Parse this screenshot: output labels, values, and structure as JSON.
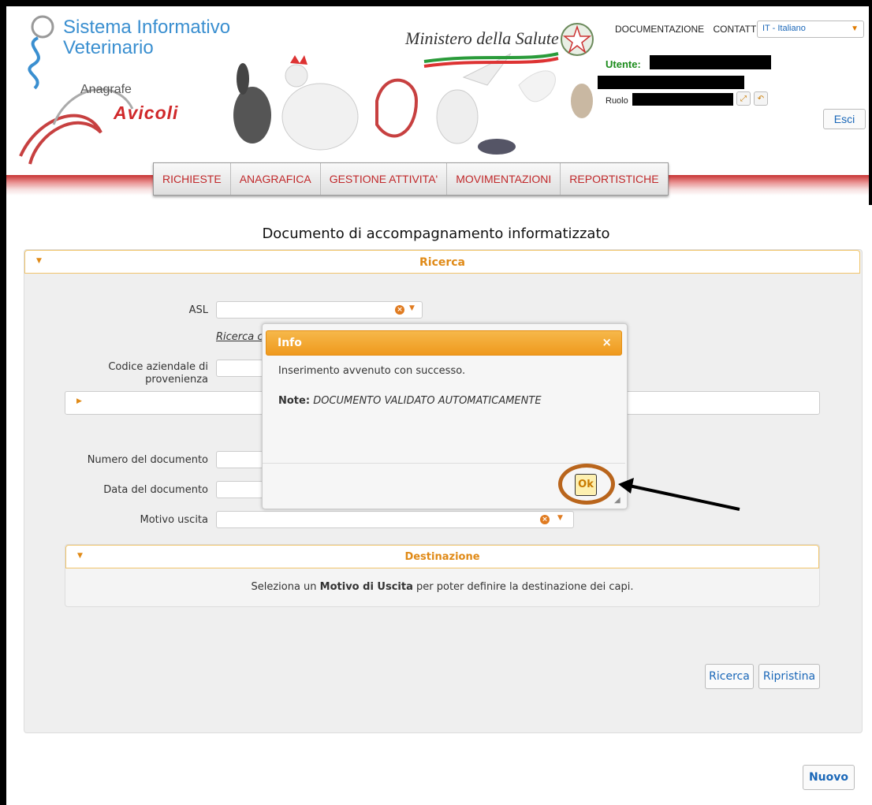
{
  "header": {
    "title_line1": "Sistema Informativo",
    "title_line2": "Veterinario",
    "subtitle": "Anagrafe",
    "brand": "Avicoli",
    "ministry": "Ministero della Salute",
    "links": [
      "DOCUMENTAZIONE",
      "CONTATTI"
    ],
    "language": "IT - Italiano",
    "user_label": "Utente:",
    "role_label": "Ruolo",
    "logout": "Esci"
  },
  "nav": [
    "RICHIESTE",
    "ANAGRAFICA",
    "GESTIONE ATTIVITA'",
    "MOVIMENTAZIONI",
    "REPORTISTICHE"
  ],
  "page": {
    "title": "Documento di accompagnamento informatizzato",
    "search_panel": "Ricerca",
    "fields": {
      "asl": "ASL",
      "ricerca_link": "Ricerca c",
      "codice_line1": "Codice aziendale di",
      "codice_line2": "provenienza",
      "numero": "Numero del documento",
      "data": "Data del documento",
      "motivo": "Motivo uscita"
    },
    "destination": {
      "title": "Destinazione",
      "msg_pre": "Seleziona un ",
      "msg_bold": "Motivo di Uscita",
      "msg_post": " per poter definire la destinazione dei capi."
    },
    "buttons": {
      "search": "Ricerca",
      "reset": "Ripristina",
      "new": "Nuovo"
    }
  },
  "dialog": {
    "title": "Info",
    "close": "×",
    "message": "Inserimento avvenuto con successo.",
    "note_label": "Note:",
    "note_value": "DOCUMENTO VALIDATO AUTOMATICAMENTE",
    "ok": "Ok"
  },
  "colors": {
    "accent": "#e08a17",
    "nav_text": "#c0282a",
    "link_blue": "#1a67b8",
    "annotation": "#b9651c"
  }
}
